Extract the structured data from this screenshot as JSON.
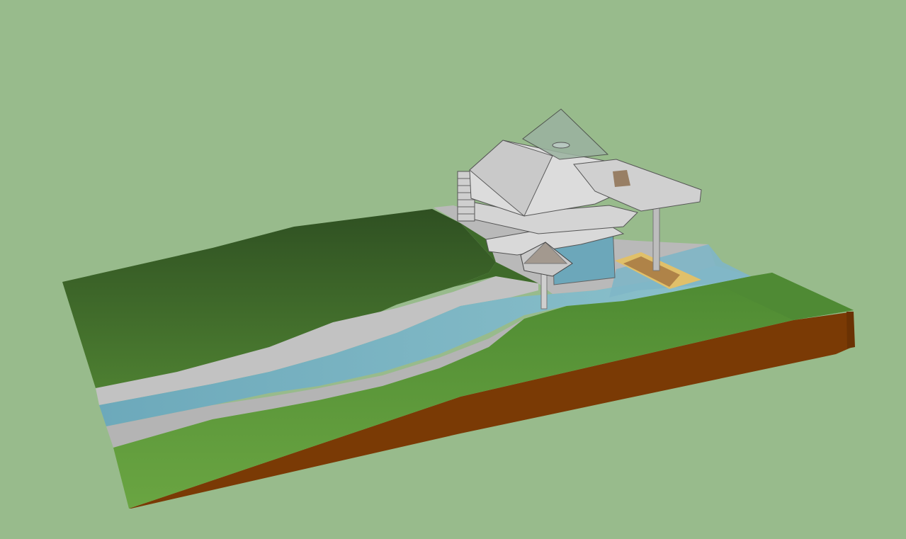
{
  "colors": {
    "sky": "#98bb8c",
    "grass_far": "#345a25",
    "grass_near": "#5a9438",
    "grass_right": "#4f8a34",
    "soil": "#7a3a05",
    "soil_dark": "#5f2c04",
    "concrete": "#c2c2c2",
    "concrete_dark": "#9e9e9e",
    "water": "#7fb6c6",
    "water_dark": "#5a98ad",
    "building": "#d9d9d9",
    "glass": "#a8c8c8",
    "wood": "#e0c06a",
    "wood_brown": "#9a6a3a"
  },
  "scene": {
    "description_icons": [
      "terrain-model",
      "river",
      "house",
      "bridge"
    ]
  }
}
